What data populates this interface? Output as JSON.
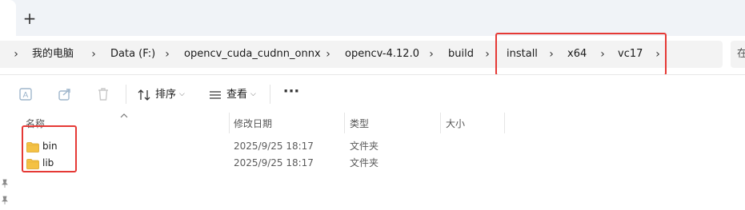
{
  "tabs": {
    "new_tab_label": "+",
    "overflow_glyph": "⌵"
  },
  "breadcrumb": {
    "items": [
      {
        "label": "我的电脑"
      },
      {
        "label": "Data (F:)"
      },
      {
        "label": "opencv_cuda_cudnn_onnx"
      },
      {
        "label": "opencv-4.12.0"
      },
      {
        "label": "build"
      },
      {
        "label": "install"
      },
      {
        "label": "x64"
      },
      {
        "label": "vc17"
      }
    ],
    "separator": "›"
  },
  "search": {
    "placeholder": "在"
  },
  "toolbar": {
    "sort_label": "排序",
    "view_label": "查看",
    "more_label": "···"
  },
  "columns": {
    "name": "名称",
    "date_modified": "修改日期",
    "type": "类型",
    "size": "大小"
  },
  "files": [
    {
      "name": "bin",
      "date_modified": "2025/9/25 18:17",
      "type": "文件夹",
      "size": ""
    },
    {
      "name": "lib",
      "date_modified": "2025/9/25 18:17",
      "type": "文件夹",
      "size": ""
    }
  ],
  "colors": {
    "highlight": "#e53935",
    "folder": "#f4c144",
    "toolbar_icon_disabled": "#9fb6cc"
  }
}
